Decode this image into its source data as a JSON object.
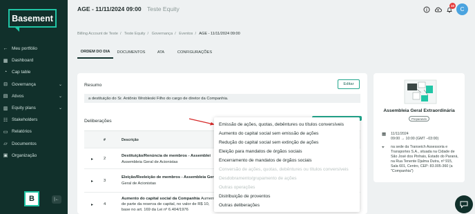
{
  "sidebar": {
    "logo": "Basement",
    "items": [
      {
        "label": "Meu portfólio",
        "icon": "arrow-left-icon"
      },
      {
        "label": "Dashboard",
        "icon": "dashboard-icon"
      },
      {
        "label": "Cap table",
        "icon": "pie-icon"
      },
      {
        "label": "Governança",
        "icon": "governance-icon",
        "chevron": "⌄"
      },
      {
        "label": "Ativos",
        "icon": "assets-icon",
        "chevron": "⌄"
      },
      {
        "label": "Equity plans",
        "icon": "chart-icon",
        "chevron": "⌄"
      },
      {
        "label": "Stakeholders",
        "icon": "people-icon"
      },
      {
        "label": "Relatórios",
        "icon": "report-icon"
      },
      {
        "label": "Documentos",
        "icon": "folder-icon"
      },
      {
        "label": "Organização",
        "icon": "org-icon"
      }
    ],
    "badge": "B",
    "collapse": "|←"
  },
  "header": {
    "title": "AGE - 11/11/2024 09:00",
    "subtitle": "Teste Equity",
    "notification_count": "10",
    "avatar_initial": "C"
  },
  "breadcrumb": [
    "Billing Account de Teste",
    "Teste Equity",
    "Governança",
    "Eventos",
    "AGE - 11/11/2024 09:00"
  ],
  "tabs": [
    "ORDEM DO DIA",
    "DOCUMENTOS",
    "ATA",
    "CONFIGURAÇÕES"
  ],
  "main": {
    "resumo_title": "Resumo",
    "edit_label": "Editar",
    "summary_text": "a destituição do Sr. Antônio Wrobleski Filho do cargo de diretor da Companhia.",
    "deliberacoes_title": "Deliberações",
    "table_headers": {
      "num": "#",
      "desc": "Descrição"
    },
    "rows": [
      {
        "num": "2",
        "title": "Destituição/Renúncia de membros - Assemblei",
        "sub": "Assembleia Geral de Acionistas"
      },
      {
        "num": "3",
        "title": "Eleição/Reeleição de membros - Assembleia Ger",
        "sub": "Geral de Acionistas"
      },
      {
        "num": "4",
        "title": "Aumento do capital social da Companhia",
        "title_rest": "Aument",
        "sub": "de parte da reserva de capital, no valor de R$ 10,",
        "sub2": "base no art. 169 da Lei nº 6.404/1976"
      }
    ]
  },
  "event_card": {
    "title": "Assembleia Geral Extraordinária",
    "status": "Preparando",
    "date_line1": "11/11/2024",
    "date_line2": "09:00 → 10:00 (GMT −03:00)",
    "location": "na sede da Transeich Assessoria e Transportes S.A., situada na Cidade de São José dos Pinhais, Estado do Paraná, na Rua Tenente Djalma Dutra, nº 915, Sala 601, Centro, CEP: 83.005-360 (a \"Companhia\")"
  },
  "dropdown": {
    "items": [
      {
        "label": "Emissão de ações, quotas, debêntures ou títulos conversíveis",
        "enabled": true
      },
      {
        "label": "Aumento do capital social sem emissão de ações",
        "enabled": true
      },
      {
        "label": "Redução do capital social sem extinção de ações",
        "enabled": true
      },
      {
        "label": "Eleição para mandatos de órgãos sociais",
        "enabled": true
      },
      {
        "label": "Encerramento de mandatos de órgãos sociais",
        "enabled": true
      },
      {
        "label": "Conversão de ações, quotas, debêntures ou títulos conversíveis",
        "enabled": false
      },
      {
        "label": "Desdobramento/grupamento de ações",
        "enabled": false
      },
      {
        "label": "Outras operações",
        "enabled": false
      },
      {
        "label": "Distribuição de proventos",
        "enabled": true
      },
      {
        "label": "Outras deliberações",
        "enabled": true
      }
    ]
  },
  "colors": {
    "sidebar_bg": "#11302b",
    "accent": "#21c6a6",
    "arrow": "#d62828"
  }
}
